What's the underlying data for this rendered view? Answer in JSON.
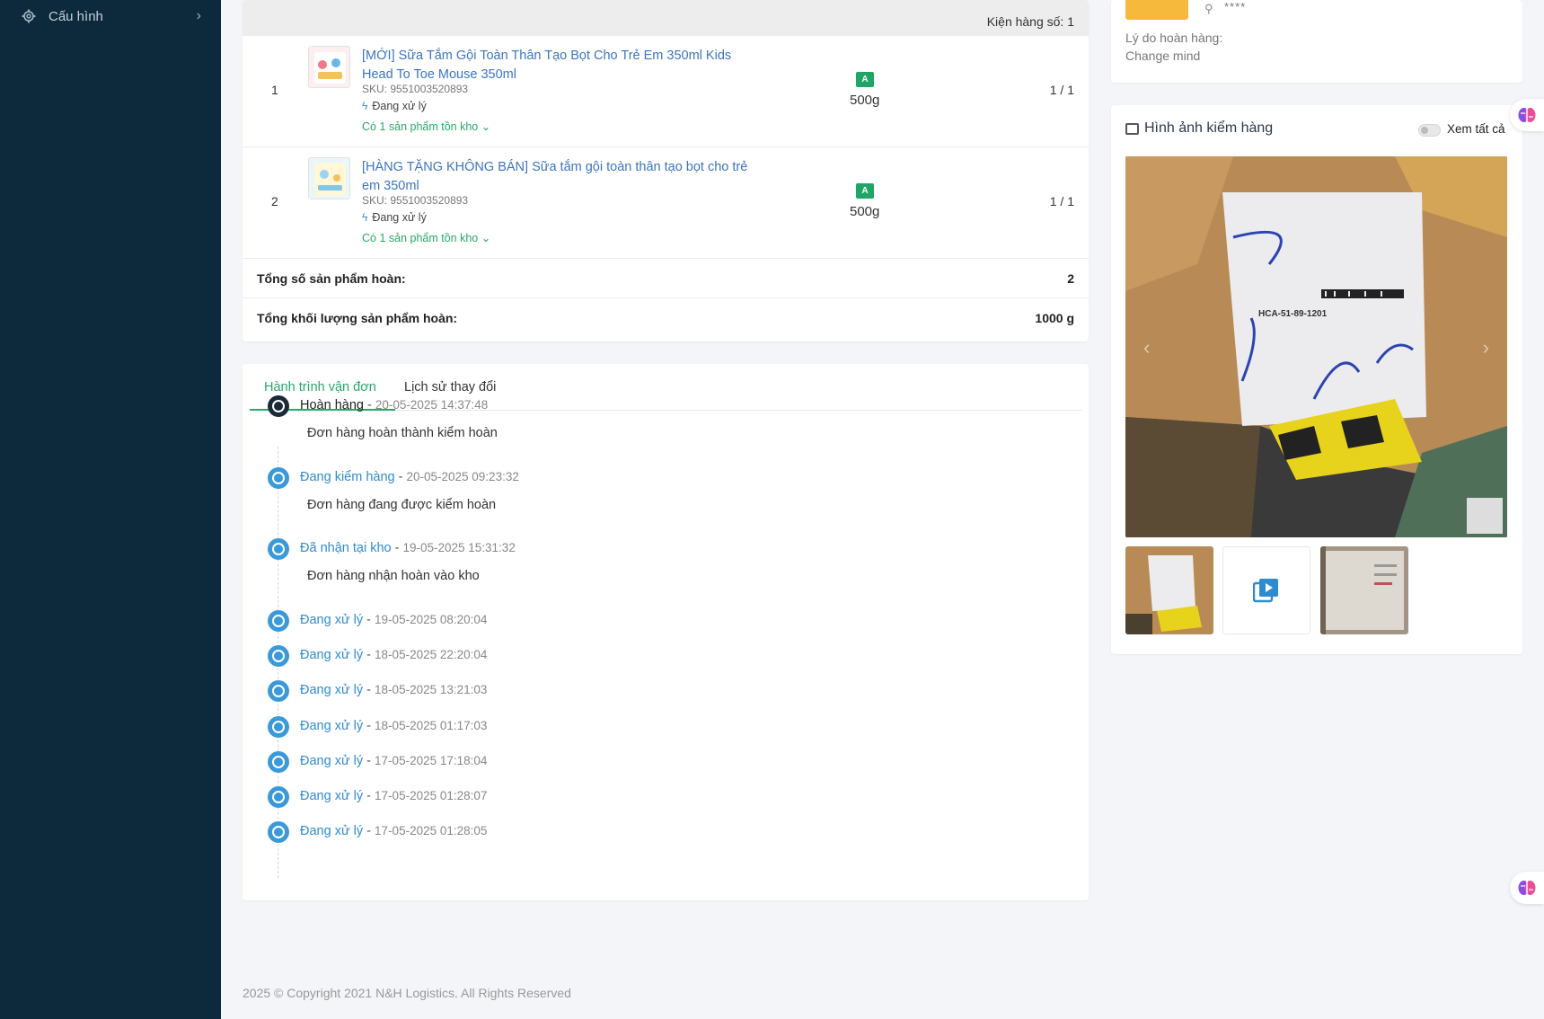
{
  "sidebar": {
    "items": [
      {
        "label": "Cấu hình",
        "icon": "gear-icon"
      }
    ]
  },
  "package": {
    "header": "Kiện hàng số: 1",
    "products": [
      {
        "index": "1",
        "name": "[MỚI] Sữa Tắm Gội Toàn Thân Tạo Bọt Cho Trẻ Em 350ml Kids Head To Toe Mouse 350ml",
        "sku": "SKU: 9551003520893",
        "status": "Đang xử lý",
        "stock": "Có 1 sản phẩm tồn kho",
        "grade": "A",
        "weight": "500g",
        "qty": "1 / 1"
      },
      {
        "index": "2",
        "name": "[HÀNG TẶNG KHÔNG BÁN] Sữa tắm gội toàn thân tạo bọt cho trẻ em 350ml",
        "sku": "SKU: 9551003520893",
        "status": "Đang xử lý",
        "stock": "Có 1 sản phẩm tồn kho",
        "grade": "A",
        "weight": "500g",
        "qty": "1 / 1"
      }
    ],
    "totals": [
      {
        "label": "Tổng số sản phẩm hoàn:",
        "value": "2"
      },
      {
        "label": "Tổng khối lượng sản phẩm hoàn:",
        "value": "1000 g"
      }
    ]
  },
  "journey": {
    "tabs": [
      "Hành trình vận đơn",
      "Lịch sử thay đổi"
    ],
    "events": [
      {
        "status": "Hoàn hàng",
        "time": "20-05-2025 14:37:48",
        "desc": "Đơn hàng hoàn thành kiểm hoàn"
      },
      {
        "status": "Đang kiểm hàng",
        "time": "20-05-2025 09:23:32",
        "desc": "Đơn hàng đang được kiểm hoàn"
      },
      {
        "status": "Đã nhận tại kho",
        "time": "19-05-2025 15:31:32",
        "desc": "Đơn hàng nhận hoàn vào kho"
      },
      {
        "status": "Đang xử lý",
        "time": "19-05-2025 08:20:04"
      },
      {
        "status": "Đang xử lý",
        "time": "18-05-2025 22:20:04"
      },
      {
        "status": "Đang xử lý",
        "time": "18-05-2025 13:21:03"
      },
      {
        "status": "Đang xử lý",
        "time": "18-05-2025 01:17:03"
      },
      {
        "status": "Đang xử lý",
        "time": "17-05-2025 17:18:04"
      },
      {
        "status": "Đang xử lý",
        "time": "17-05-2025 01:28:07"
      },
      {
        "status": "Đang xử lý",
        "time": "17-05-2025 01:28:05"
      }
    ]
  },
  "return_info": {
    "masked": "****",
    "reason_label": "Lý do hoàn hàng:",
    "reason_value": "Change mind"
  },
  "inspection": {
    "title": "Hình ảnh kiểm hàng",
    "toggle_label": "Xem tất cả",
    "photo_label_text": "HCA-51-89-1201",
    "handwriting": "SP 0507 6/15 4 8 34 3A"
  },
  "footer": {
    "copyright": "2025 © Copyright 2021 N&H Logistics. All Rights Reserved"
  },
  "colors": {
    "sidebar_bg": "#0d2a3c",
    "accent_green": "#28a86a",
    "link_blue": "#3b74c2",
    "timeline_blue": "#3a9ad9"
  }
}
